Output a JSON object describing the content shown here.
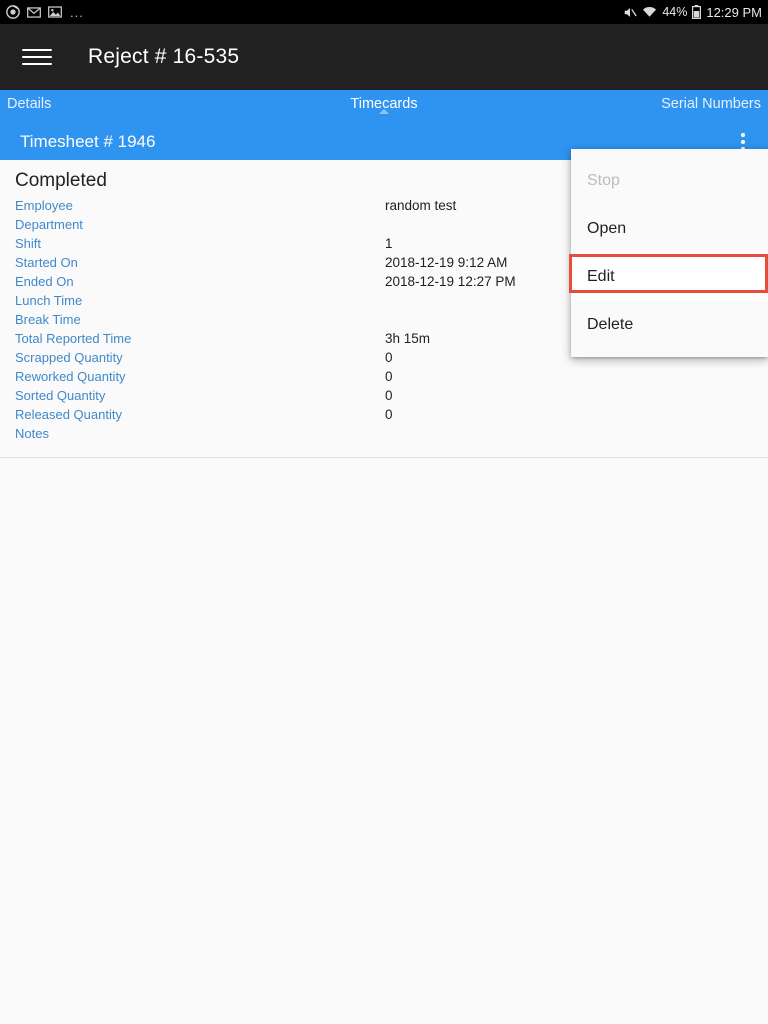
{
  "statusbar": {
    "left_icons": [
      "chrome-icon",
      "mail-icon",
      "image-icon"
    ],
    "ellipsis": "...",
    "mute_icon": "mute-icon",
    "wifi_icon": "wifi-icon",
    "battery_percent": "44%",
    "battery_icon": "battery-icon",
    "time": "12:29 PM"
  },
  "appbar": {
    "menu_icon": "hamburger-menu-icon",
    "title": "Reject # 16-535"
  },
  "tabs": [
    {
      "label": "Details",
      "active": false
    },
    {
      "label": "Timecards",
      "active": true
    },
    {
      "label": "Serial Numbers",
      "active": false
    }
  ],
  "subheader": {
    "title": "Timesheet # 1946",
    "overflow_icon": "overflow-menu-icon"
  },
  "panel": {
    "heading": "Completed",
    "rows": [
      {
        "label": "Employee",
        "value": "random test"
      },
      {
        "label": "Department",
        "value": ""
      },
      {
        "label": "Shift",
        "value": "1"
      },
      {
        "label": "Started On",
        "value": "2018-12-19 9:12 AM"
      },
      {
        "label": "Ended On",
        "value": "2018-12-19 12:27 PM"
      },
      {
        "label": "Lunch Time",
        "value": ""
      },
      {
        "label": "Break Time",
        "value": ""
      },
      {
        "label": "Total Reported Time",
        "value": "3h 15m"
      },
      {
        "label": "Scrapped Quantity",
        "value": "0"
      },
      {
        "label": "Reworked Quantity",
        "value": "0"
      },
      {
        "label": "Sorted Quantity",
        "value": "0"
      },
      {
        "label": "Released Quantity",
        "value": "0"
      },
      {
        "label": "Notes",
        "value": ""
      }
    ]
  },
  "popup_menu": {
    "items": [
      {
        "label": "Stop",
        "state": "disabled"
      },
      {
        "label": "Open",
        "state": "enabled"
      },
      {
        "label": "Edit",
        "state": "highlighted"
      },
      {
        "label": "Delete",
        "state": "enabled"
      }
    ]
  },
  "colors": {
    "accent_blue": "#2f93f0",
    "label_blue": "#4089c9",
    "appbar_dark": "#212121",
    "highlight_red": "#e74c3c",
    "page_background": "#fafafa"
  }
}
